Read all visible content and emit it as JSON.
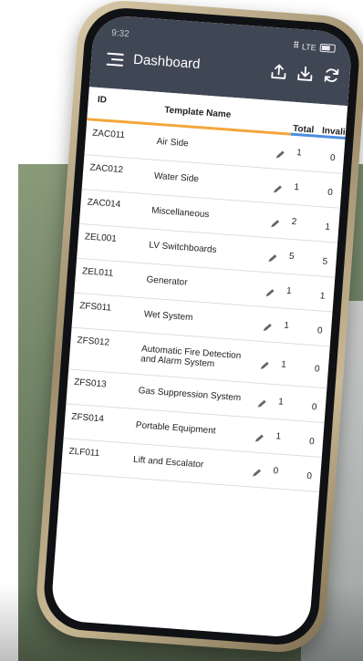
{
  "status": {
    "time": "9:32",
    "network": "LTE"
  },
  "header": {
    "title": "Dashboard"
  },
  "table": {
    "columns": {
      "id": "ID",
      "name": "Template Name",
      "total": "Total",
      "invalid": "Invalid"
    },
    "rows": [
      {
        "id": "ZAC011",
        "name": "Air Side",
        "total": "1",
        "invalid": "0"
      },
      {
        "id": "ZAC012",
        "name": "Water Side",
        "total": "1",
        "invalid": "0"
      },
      {
        "id": "ZAC014",
        "name": "Miscellaneous",
        "total": "2",
        "invalid": "1"
      },
      {
        "id": "ZEL001",
        "name": "LV Switchboards",
        "total": "5",
        "invalid": "5"
      },
      {
        "id": "ZEL011",
        "name": "Generator",
        "total": "1",
        "invalid": "1"
      },
      {
        "id": "ZFS011",
        "name": "Wet System",
        "total": "1",
        "invalid": "0"
      },
      {
        "id": "ZFS012",
        "name": "Automatic Fire Detection and Alarm System",
        "total": "1",
        "invalid": "0"
      },
      {
        "id": "ZFS013",
        "name": "Gas Suppression System",
        "total": "1",
        "invalid": "0"
      },
      {
        "id": "ZFS014",
        "name": "Portable Equipment",
        "total": "1",
        "invalid": "0"
      },
      {
        "id": "ZLF011",
        "name": "Lift and Escalator",
        "total": "0",
        "invalid": "0"
      }
    ]
  },
  "colors": {
    "appbar": "#3f4654",
    "accent_orange": "#f4a63a",
    "accent_blue": "#4b8de0"
  },
  "icons": {
    "menu": "menu-icon",
    "upload": "upload-icon",
    "download": "download-icon",
    "sync": "sync-icon",
    "edit": "pencil-icon",
    "chevron": "chevron-right-icon"
  }
}
